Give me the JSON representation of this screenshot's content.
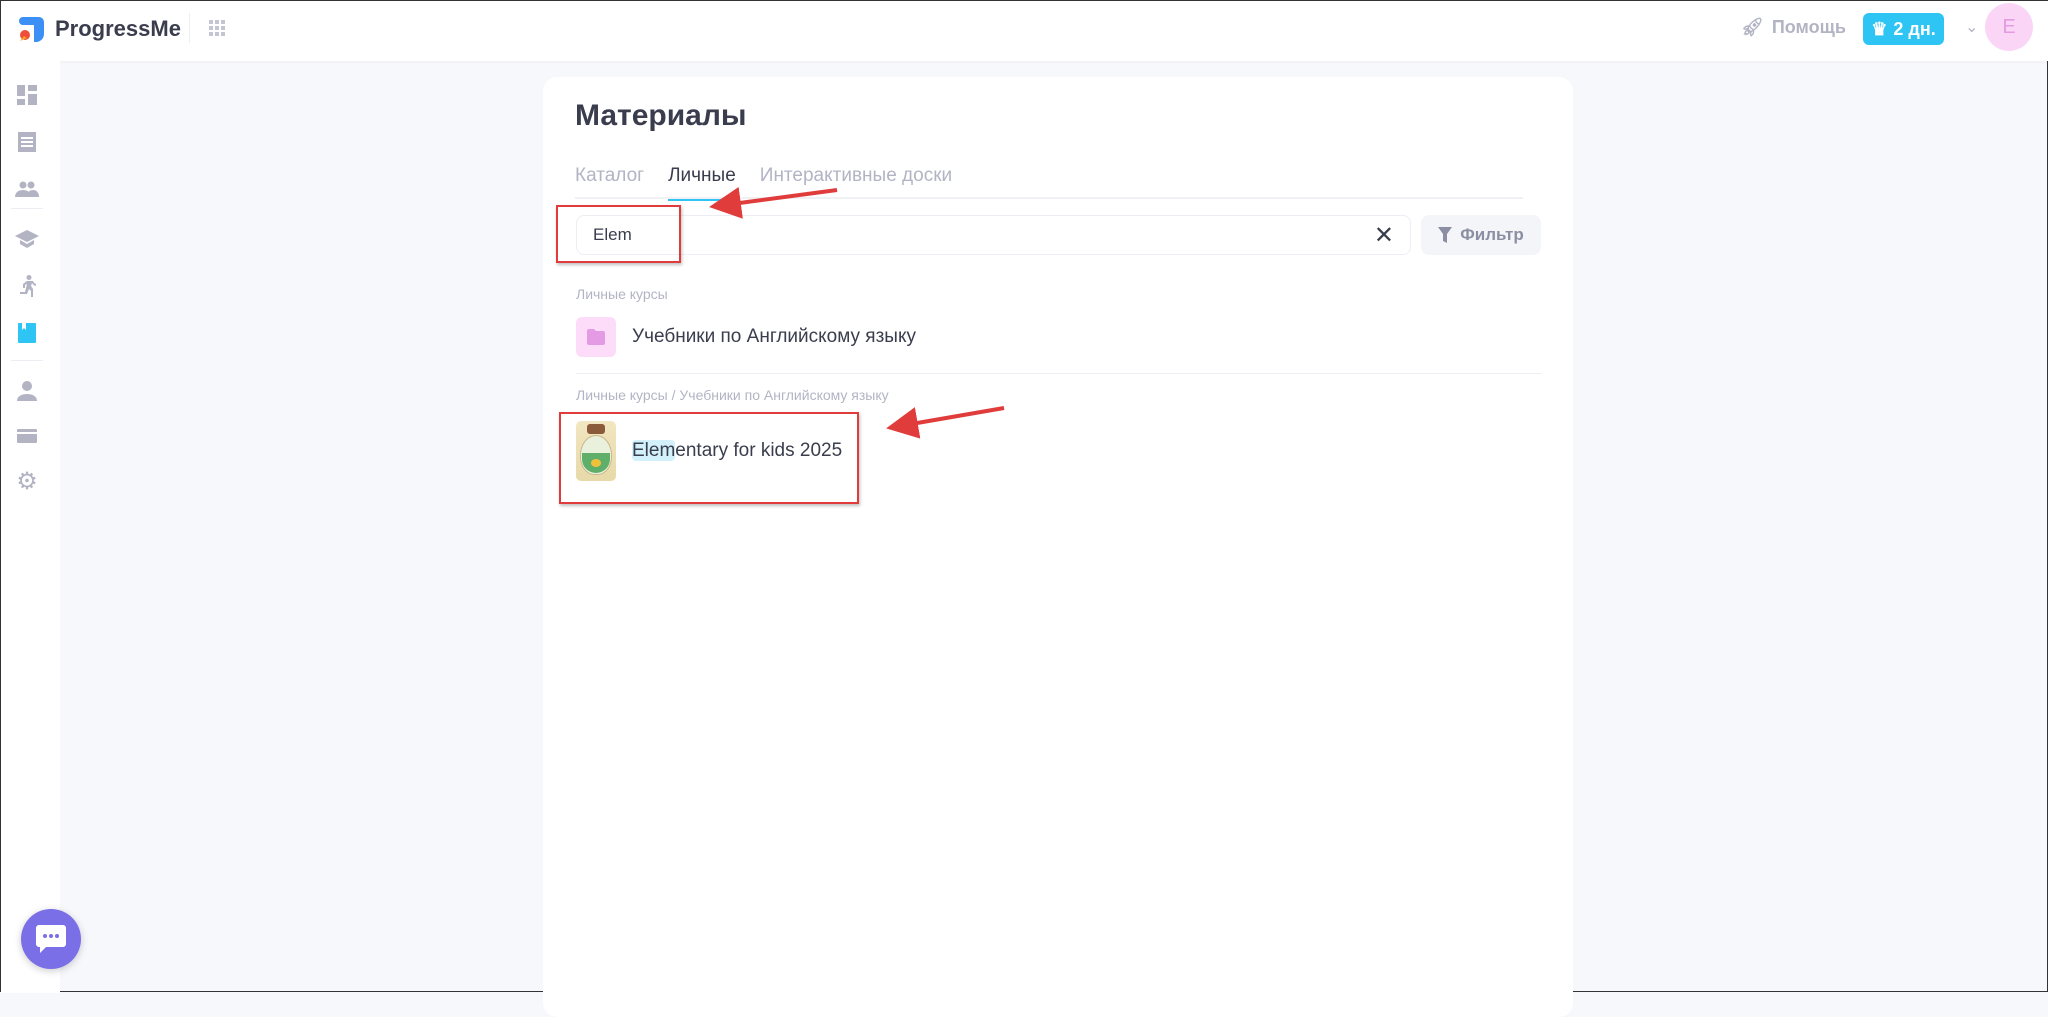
{
  "app": {
    "name": "ProgressMe"
  },
  "topbar": {
    "help_label": "Помощь",
    "subscription_badge": "2 дн.",
    "avatar_initial": "E"
  },
  "page": {
    "title": "Материалы"
  },
  "tabs": [
    {
      "label": "Каталог",
      "active": false
    },
    {
      "label": "Личные",
      "active": true
    },
    {
      "label": "Интерактивные доски",
      "active": false
    }
  ],
  "search": {
    "value": "Elem"
  },
  "filter": {
    "label": "Фильтр"
  },
  "results": {
    "section1_label": "Личные курсы",
    "folder_title": "Учебники по Английскому языку",
    "section2_label": "Личные курсы / Учебники по Английскому языку",
    "course_title_match": "Elem",
    "course_title_rest": "entary for kids 2025"
  },
  "colors": {
    "accent": "#2ec5f5",
    "annotation": "#e03c3c",
    "chat": "#7b6fe8"
  }
}
